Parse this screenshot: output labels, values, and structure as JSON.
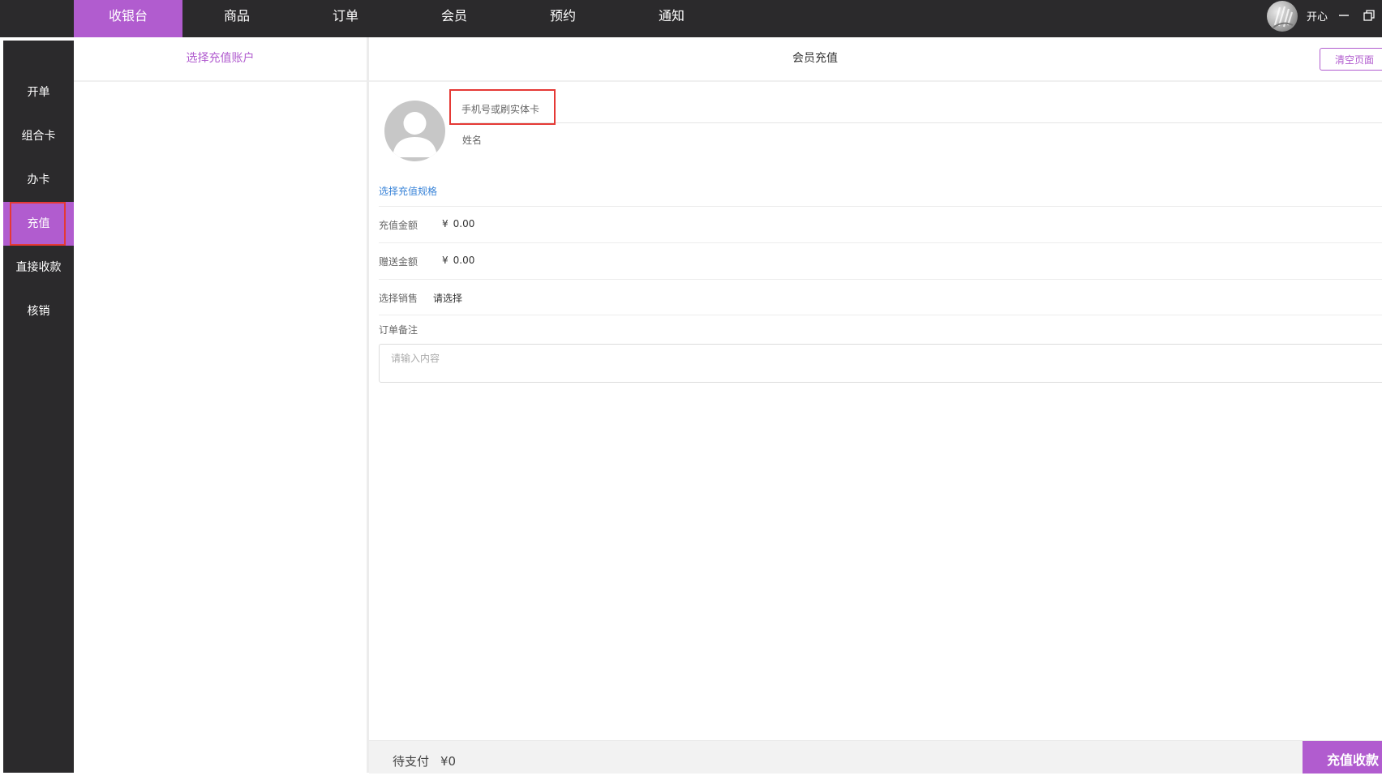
{
  "top_nav": {
    "tabs": [
      {
        "label": "收银台",
        "active": true
      },
      {
        "label": "商品"
      },
      {
        "label": "订单"
      },
      {
        "label": "会员"
      },
      {
        "label": "预约"
      },
      {
        "label": "通知"
      }
    ],
    "user_name": "开心"
  },
  "sidebar": {
    "items": [
      {
        "label": "开单"
      },
      {
        "label": "组合卡"
      },
      {
        "label": "办卡"
      },
      {
        "label": "充值",
        "active": true
      },
      {
        "label": "直接收款"
      },
      {
        "label": "核销"
      }
    ]
  },
  "account_panel": {
    "title": "选择充值账户"
  },
  "main": {
    "title": "会员充值",
    "clear_button": "清空页面",
    "phone_placeholder": "手机号或刷实体卡",
    "name_label": "姓名",
    "spec_link": "选择充值规格",
    "recharge_label": "充值金额",
    "recharge_currency": "¥",
    "recharge_value": "0.00",
    "gift_label": "赠送金额",
    "gift_currency": "¥",
    "gift_value": "0.00",
    "sales_label": "选择销售",
    "sales_link": "请选择",
    "notes_label": "订单备注",
    "notes_placeholder": "请输入内容"
  },
  "footer": {
    "pending_label": "待支付",
    "pending_amount": "¥0",
    "pay_button": "充值收款"
  },
  "colors": {
    "accent": "#b15ccf",
    "dark": "#2b2a2c",
    "link": "#3a84d8",
    "highlight": "#e53935"
  }
}
